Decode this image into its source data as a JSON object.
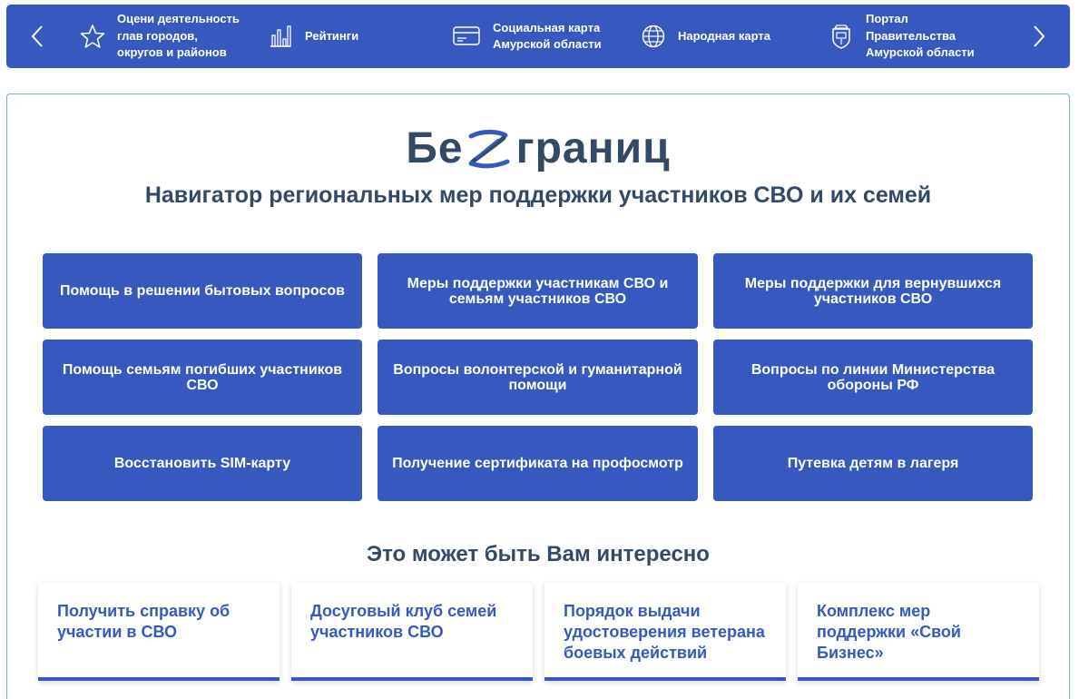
{
  "topnav": {
    "items": [
      {
        "label": "Оцени деятельность\nглав городов,\nокругов и районов",
        "icon": "star-icon"
      },
      {
        "label": "Рейтинги",
        "icon": "bar-chart-icon"
      },
      {
        "label": "Социальная карта\nАмурской области",
        "icon": "card-icon"
      },
      {
        "label": "Народная карта",
        "icon": "globe-icon"
      },
      {
        "label": "Портал\nПравительства\nАмурской области",
        "icon": "coat-of-arms-icon"
      }
    ]
  },
  "header": {
    "logo_part1": "Бе",
    "logo_part2": "границ",
    "subtitle": "Навигатор региональных мер поддержки участников СВО и их семей"
  },
  "tiles": [
    {
      "label": "Помощь в решении бытовых вопросов"
    },
    {
      "label": "Меры поддержки участникам СВО и семьям участников СВО"
    },
    {
      "label": "Меры поддержки для вернувшихся участников СВО"
    },
    {
      "label": "Помощь семьям погибших участников СВО"
    },
    {
      "label": "Вопросы волонтерской и гуманитарной помощи"
    },
    {
      "label": "Вопросы по линии Министерства обороны РФ"
    },
    {
      "label": "Восстановить SIM-карту"
    },
    {
      "label": "Получение сертификата на профосмотр"
    },
    {
      "label": "Путевка детям в лагеря"
    }
  ],
  "interest": {
    "title": "Это может быть Вам интересно",
    "cards": [
      {
        "label": "Получить справку об участии в СВО"
      },
      {
        "label": "Досуговый клуб семей участников СВО"
      },
      {
        "label": "Порядок выдачи удостоверения ветерана боевых действий"
      },
      {
        "label": "Комплекс мер поддержки «Свой Бизнес»"
      }
    ]
  },
  "colors": {
    "primary": "#3559be",
    "heading": "#334a66",
    "border": "#6fb2d8"
  }
}
